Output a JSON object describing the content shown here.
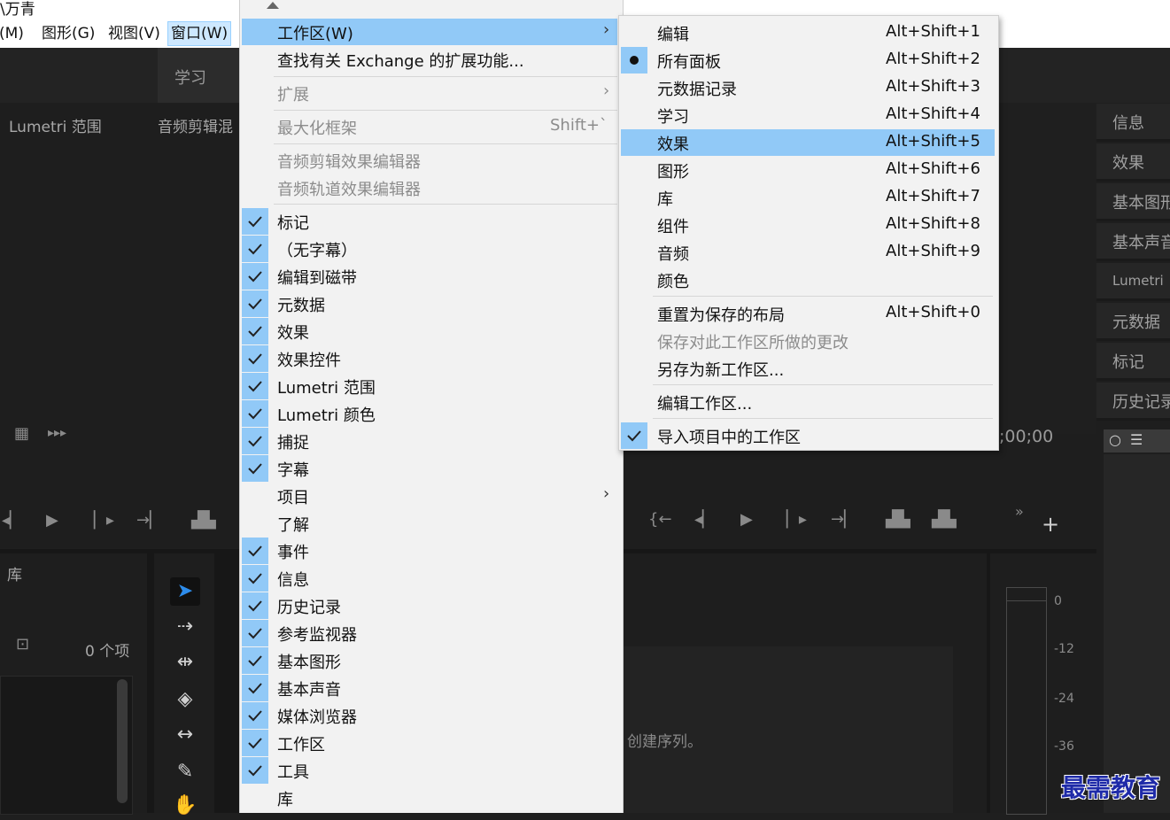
{
  "title": {
    "text": "\\万青"
  },
  "menubar": {
    "items": [
      "(M)",
      "图形(G)",
      "视图(V)",
      "窗口(W)"
    ]
  },
  "workspace_tabs": [
    "学习"
  ],
  "panels": {
    "lumetri_scope": "Lumetri 范围",
    "audio_clip_mixer": "音频剪辑混",
    "library": "库",
    "library_count": "0 个项",
    "timecode": ";00;00",
    "seq_hint": "创建序列。"
  },
  "right_panel_tabs": [
    "信息",
    "效果",
    "基本图形",
    "基本声音",
    "Lumetri",
    "元数据",
    "标记",
    "历史记录"
  ],
  "meter_scale": [
    "0",
    "-12",
    "-24",
    "-36"
  ],
  "menu1": {
    "items": [
      {
        "label": "工作区(W)",
        "highlight": true,
        "submenu": true
      },
      {
        "label": "查找有关 Exchange 的扩展功能..."
      },
      {
        "label": "扩展",
        "disabled": true,
        "submenu": true
      },
      {
        "label": "最大化框架",
        "disabled": true,
        "shortcut": "Shift+`"
      },
      {
        "label": "音频剪辑效果编辑器",
        "disabled": true
      },
      {
        "label": "音频轨道效果编辑器",
        "disabled": true
      },
      {
        "label": "标记",
        "checked": true
      },
      {
        "label": "（无字幕）",
        "checked": true
      },
      {
        "label": "编辑到磁带",
        "checked": true
      },
      {
        "label": "元数据",
        "checked": true
      },
      {
        "label": "效果",
        "checked": true
      },
      {
        "label": "效果控件",
        "checked": true
      },
      {
        "label": "Lumetri 范围",
        "checked": true
      },
      {
        "label": "Lumetri 颜色",
        "checked": true
      },
      {
        "label": "捕捉",
        "checked": true
      },
      {
        "label": "字幕",
        "checked": true
      },
      {
        "label": "项目",
        "submenu": true
      },
      {
        "label": "了解"
      },
      {
        "label": "事件",
        "checked": true
      },
      {
        "label": "信息",
        "checked": true
      },
      {
        "label": "历史记录",
        "checked": true
      },
      {
        "label": "参考监视器",
        "checked": true
      },
      {
        "label": "基本图形",
        "checked": true
      },
      {
        "label": "基本声音",
        "checked": true
      },
      {
        "label": "媒体浏览器",
        "checked": true
      },
      {
        "label": "工作区",
        "checked": true
      },
      {
        "label": "工具",
        "checked": true
      },
      {
        "label": "库"
      }
    ]
  },
  "menu2": {
    "items": [
      {
        "label": "编辑",
        "shortcut": "Alt+Shift+1"
      },
      {
        "label": "所有面板",
        "shortcut": "Alt+Shift+2",
        "radio": true
      },
      {
        "label": "元数据记录",
        "shortcut": "Alt+Shift+3"
      },
      {
        "label": "学习",
        "shortcut": "Alt+Shift+4"
      },
      {
        "label": "效果",
        "shortcut": "Alt+Shift+5",
        "highlight": true
      },
      {
        "label": "图形",
        "shortcut": "Alt+Shift+6"
      },
      {
        "label": "库",
        "shortcut": "Alt+Shift+7"
      },
      {
        "label": "组件",
        "shortcut": "Alt+Shift+8"
      },
      {
        "label": "音频",
        "shortcut": "Alt+Shift+9"
      },
      {
        "label": "颜色"
      },
      {
        "label": "重置为保存的布局",
        "shortcut": "Alt+Shift+0"
      },
      {
        "label": "保存对此工作区所做的更改",
        "disabled": true
      },
      {
        "label": "另存为新工作区..."
      },
      {
        "label": "编辑工作区..."
      },
      {
        "label": "导入项目中的工作区",
        "checked": true
      }
    ]
  },
  "watermark": "最需教育",
  "colors": {
    "highlight": "#91c9f7",
    "menu_bg": "#f2f2f2",
    "app_bg": "#1e1e1e"
  }
}
